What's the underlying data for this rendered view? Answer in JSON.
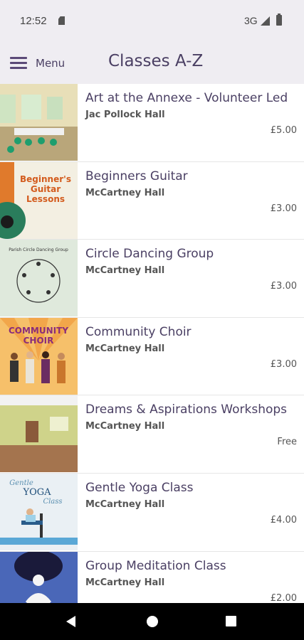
{
  "status_bar": {
    "time": "12:52",
    "network": "3G",
    "icons": [
      "sim-card-icon",
      "signal-icon",
      "battery-icon"
    ]
  },
  "app_bar": {
    "menu_label": "Menu",
    "title": "Classes A-Z",
    "menu_icon": "hamburger-menu-icon"
  },
  "colors": {
    "accent": "#4a3f63",
    "app_bar_bg": "#efedf2",
    "text_secondary": "#555555"
  },
  "classes": [
    {
      "title": "Art at the Annexe - Volunteer Led",
      "venue": "Jac Pollock Hall",
      "price": "£5.00"
    },
    {
      "title": "Beginners Guitar",
      "venue": "McCartney Hall",
      "price": "£3.00",
      "thumb_text": [
        "Beginner's",
        "Guitar",
        "Lessons"
      ]
    },
    {
      "title": "Circle Dancing Group",
      "venue": "McCartney Hall",
      "price": "£3.00",
      "thumb_text": [
        "Parish Circle Dancing Group"
      ]
    },
    {
      "title": "Community Choir",
      "venue": "McCartney Hall",
      "price": "£3.00",
      "thumb_text": [
        "COMMUNITY",
        "CHOIR"
      ]
    },
    {
      "title": "Dreams & Aspirations Workshops",
      "venue": "McCartney Hall",
      "price": "Free"
    },
    {
      "title": "Gentle Yoga Class",
      "venue": "McCartney Hall",
      "price": "£4.00",
      "thumb_text": [
        "Gentle",
        "YOGA",
        "Class"
      ]
    },
    {
      "title": "Group Meditation Class",
      "venue": "McCartney Hall",
      "price": "£2.00"
    }
  ],
  "nav": {
    "icons": [
      "back-icon",
      "home-icon",
      "recents-icon"
    ]
  }
}
